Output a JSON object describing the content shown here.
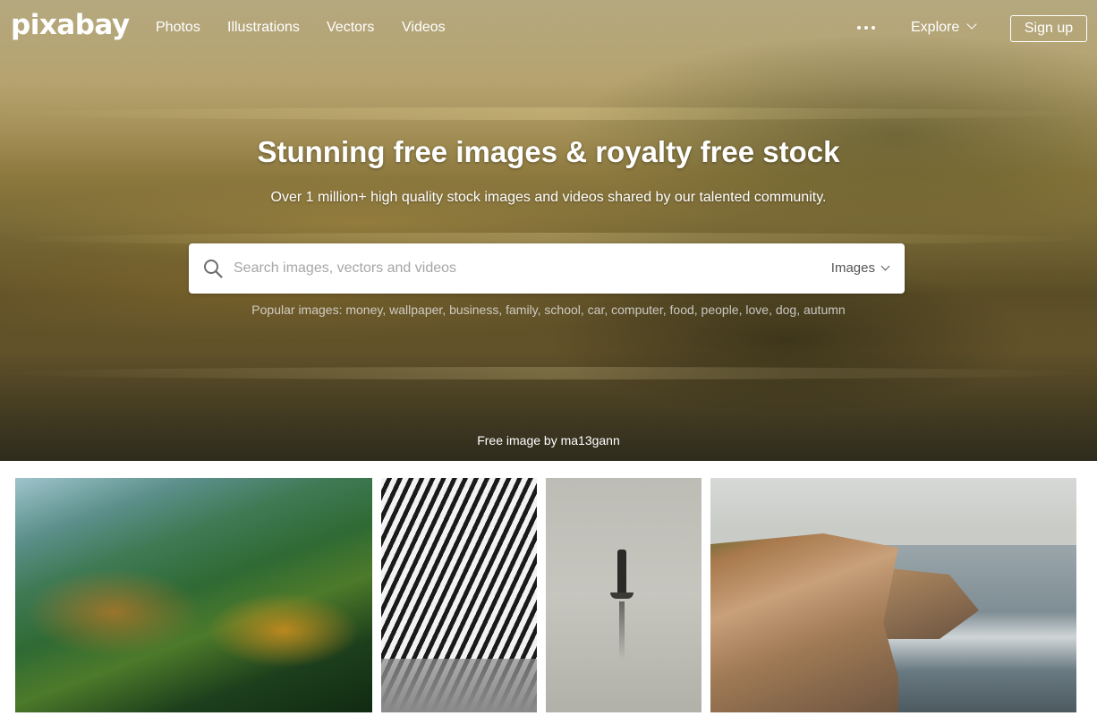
{
  "brand": {
    "logo_text": "pixabay"
  },
  "nav": {
    "links": [
      "Photos",
      "Illustrations",
      "Vectors",
      "Videos"
    ],
    "more_icon": "ellipsis-icon",
    "explore_label": "Explore",
    "signup_label": "Sign up"
  },
  "hero": {
    "headline": "Stunning free images & royalty free stock",
    "subheadline": "Over 1 million+ high quality stock images and videos shared by our talented community.",
    "search": {
      "placeholder": "Search images, vectors and videos",
      "value": "",
      "type_selected": "Images",
      "icon": "search-icon"
    },
    "popular_label": "Popular images:",
    "popular_tags": [
      "money",
      "wallpaper",
      "business",
      "family",
      "school",
      "car",
      "computer",
      "food",
      "people",
      "love",
      "dog",
      "autumn"
    ],
    "credit": "Free image by ma13gann"
  },
  "gallery": {
    "tiles": [
      {
        "subject": "autumn-mountain-valley"
      },
      {
        "subject": "zebras-grazing"
      },
      {
        "subject": "person-in-boat-on-lake"
      },
      {
        "subject": "coastal-cliffs"
      }
    ]
  },
  "colors": {
    "text_on_hero": "#ffffff",
    "search_bg": "#ffffff",
    "page_bg": "#ffffff"
  }
}
